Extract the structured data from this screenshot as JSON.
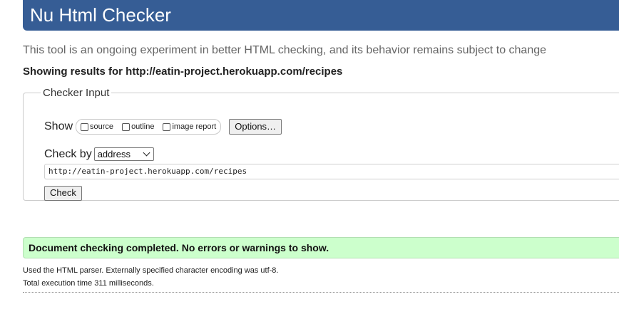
{
  "header": {
    "title": "Nu Html Checker"
  },
  "tagline": "This tool is an ongoing experiment in better HTML checking, and its behavior remains subject to change",
  "results_heading": "Showing results for http://eatin-project.herokuapp.com/recipes",
  "checker_input": {
    "legend": "Checker Input",
    "show_label": "Show",
    "options": [
      {
        "label": "source",
        "checked": false
      },
      {
        "label": "outline",
        "checked": false
      },
      {
        "label": "image report",
        "checked": false
      }
    ],
    "options_button": "Options…",
    "check_by_label": "Check by",
    "check_by_selected": "address",
    "url_value": "http://eatin-project.herokuapp.com/recipes",
    "check_button": "Check"
  },
  "result": {
    "message": "Document checking completed. No errors or warnings to show.",
    "color": "#ccffcc"
  },
  "details": {
    "parser_line": "Used the HTML parser. Externally specified character encoding was utf-8.",
    "time_line": "Total execution time 311 milliseconds."
  },
  "colors": {
    "header_bg": "#365d95",
    "success_bg": "#ccffcc"
  }
}
